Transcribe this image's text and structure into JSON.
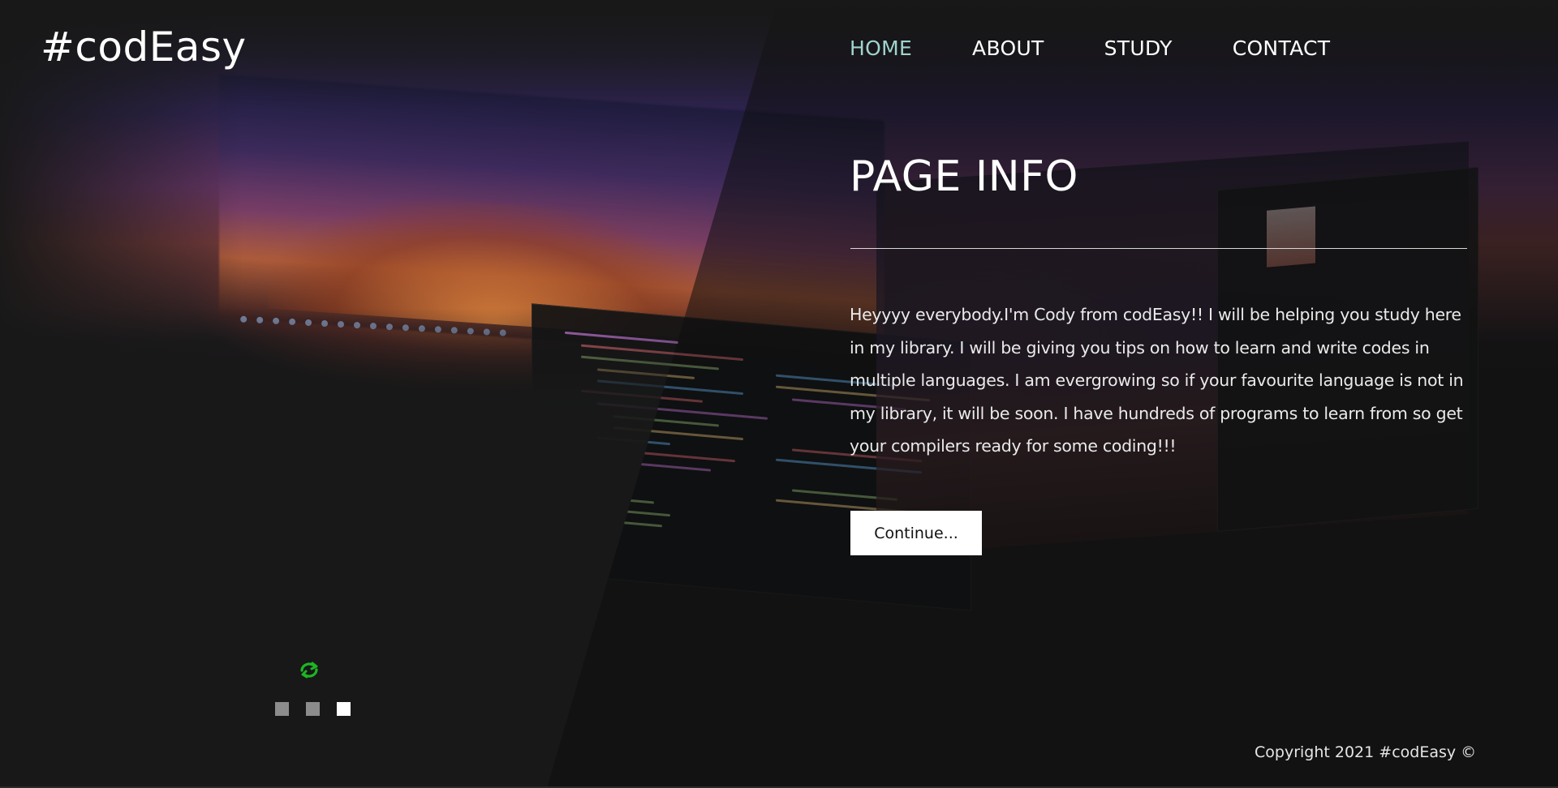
{
  "header": {
    "logo": "#codEasy"
  },
  "nav": {
    "items": [
      {
        "label": "HOME",
        "active": true
      },
      {
        "label": "ABOUT",
        "active": false
      },
      {
        "label": "STUDY",
        "active": false
      },
      {
        "label": "CONTACT",
        "active": false
      }
    ]
  },
  "main": {
    "title": "PAGE INFO",
    "body": "Heyyyy everybody.I'm Cody from codEasy!! I will be helping you study here in my library. I will be giving you tips on how to learn and write codes in multiple languages. I am evergrowing so if your favourite language is not in my library, it will be soon. I have hundreds of programs to learn from so get your compilers ready for some coding!!!",
    "button_label": "Continue..."
  },
  "slider": {
    "slide_count": 3,
    "active_index": 2,
    "refresh_icon": "refresh-icon"
  },
  "footer": {
    "copyright": "Copyright 2021 #codEasy ©"
  },
  "colors": {
    "background": "#181818",
    "nav_active": "#9fd4cf",
    "refresh_icon": "#1db523",
    "dot_inactive": "#8c8c8c",
    "dot_active": "#ffffff"
  }
}
